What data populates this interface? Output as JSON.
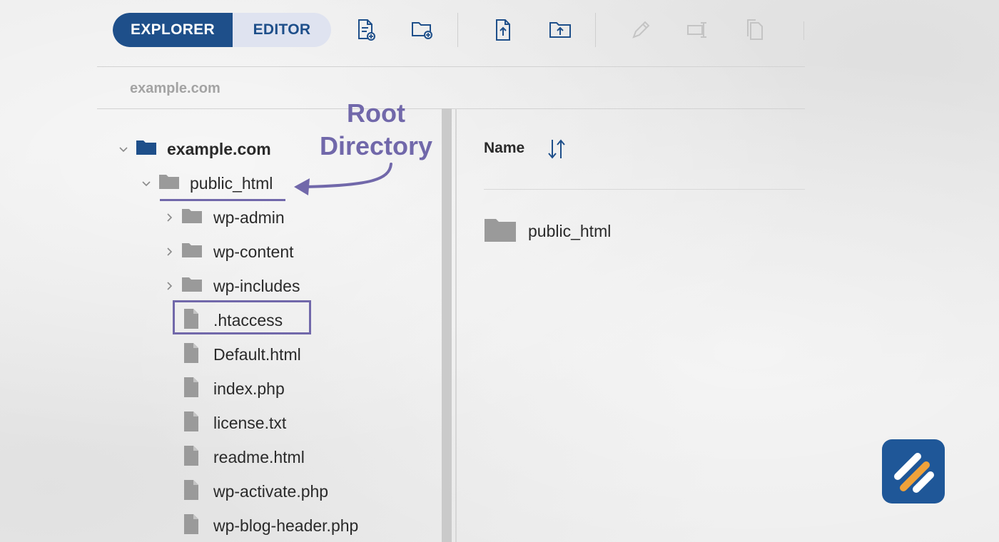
{
  "toolbar": {
    "explorer_label": "EXPLORER",
    "editor_label": "EDITOR",
    "icons": [
      "new-file-icon",
      "new-folder-icon",
      "upload-file-icon",
      "upload-folder-icon",
      "rename-icon",
      "move-icon",
      "copy-icon"
    ]
  },
  "breadcrumb": "example.com",
  "tree": {
    "root": "example.com",
    "public_html": "public_html",
    "folders": [
      "wp-admin",
      "wp-content",
      "wp-includes"
    ],
    "files": [
      ".htaccess",
      "Default.html",
      "index.php",
      "license.txt",
      "readme.html",
      "wp-activate.php",
      "wp-blog-header.php"
    ]
  },
  "list": {
    "column_name": "Name",
    "items": [
      "public_html"
    ]
  },
  "annotation": {
    "line1": "Root",
    "line2": "Directory"
  },
  "colors": {
    "accent": "#1e4f8a",
    "annotation": "#7168aa",
    "logo_bg": "#1f5798",
    "logo_stripe_white": "#ffffff",
    "logo_stripe_orange": "#f0a23a"
  }
}
